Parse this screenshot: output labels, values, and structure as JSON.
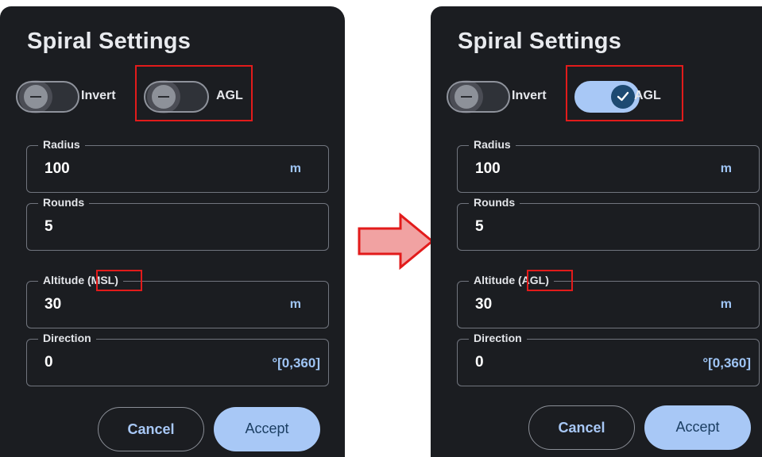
{
  "colors": {
    "panel_bg": "#1b1d21",
    "accent": "#a8c8f6",
    "highlight": "#e21b1b",
    "arrow_fill": "#f1a2a2",
    "arrow_stroke": "#e21b1b"
  },
  "before": {
    "title": "Spiral Settings",
    "toggles": [
      {
        "label": "Invert",
        "state": "off"
      },
      {
        "label": "AGL",
        "state": "off"
      }
    ],
    "fields": {
      "radius": {
        "label": "Radius",
        "value": "100",
        "unit": "m"
      },
      "rounds": {
        "label": "Rounds",
        "value": "5"
      },
      "altitude": {
        "label": "Altitude",
        "ref": "(MSL)",
        "value": "30",
        "unit": "m"
      },
      "direction": {
        "label": "Direction",
        "value": "0",
        "unit": "°[0,360]"
      }
    },
    "buttons": {
      "cancel": "Cancel",
      "accept": "Accept"
    }
  },
  "after": {
    "title": "Spiral Settings",
    "toggles": [
      {
        "label": "Invert",
        "state": "off"
      },
      {
        "label": "AGL",
        "state": "on"
      }
    ],
    "fields": {
      "radius": {
        "label": "Radius",
        "value": "100",
        "unit": "m"
      },
      "rounds": {
        "label": "Rounds",
        "value": "5"
      },
      "altitude": {
        "label": "Altitude",
        "ref": "(AGL)",
        "value": "30",
        "unit": "m"
      },
      "direction": {
        "label": "Direction",
        "value": "0",
        "unit": "°[0,360]"
      }
    },
    "buttons": {
      "cancel": "Cancel",
      "accept": "Accept"
    }
  },
  "transition_icon": "right-arrow-icon"
}
